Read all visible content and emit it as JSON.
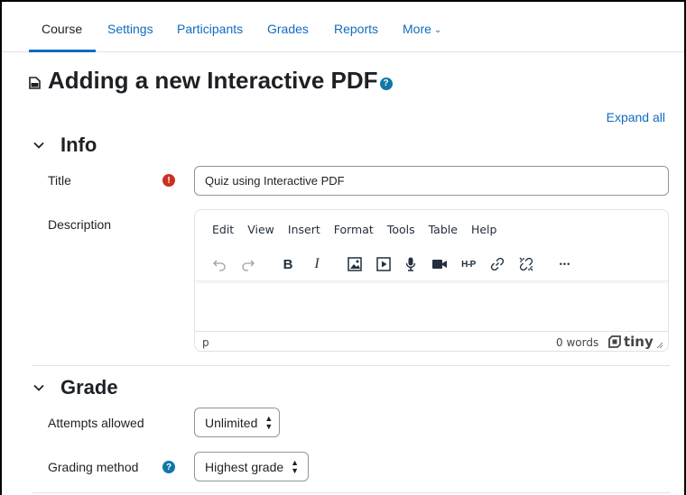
{
  "nav": {
    "tabs": [
      {
        "label": "Course",
        "active": true
      },
      {
        "label": "Settings"
      },
      {
        "label": "Participants"
      },
      {
        "label": "Grades"
      },
      {
        "label": "Reports"
      },
      {
        "label": "More"
      }
    ]
  },
  "page": {
    "title": "Adding a new Interactive PDF",
    "expand_all": "Expand all"
  },
  "info": {
    "section_title": "Info",
    "title_label": "Title",
    "title_value": "Quiz using Interactive PDF",
    "description_label": "Description"
  },
  "editor": {
    "menu": [
      "Edit",
      "View",
      "Insert",
      "Format",
      "Tools",
      "Table",
      "Help"
    ],
    "toolbar_icons": [
      "undo-icon",
      "redo-icon",
      "bold-icon",
      "italic-icon",
      "image-icon",
      "media-icon",
      "microphone-icon",
      "video-camera-icon",
      "h5p-icon",
      "link-icon",
      "unlink-icon",
      "more-icon"
    ],
    "bold_glyph": "B",
    "italic_glyph": "I",
    "h5p_glyph": "H-P",
    "more_glyph": "•••",
    "status_path": "p",
    "word_count": "0 words",
    "brand": "tiny"
  },
  "grade": {
    "section_title": "Grade",
    "attempts_label": "Attempts allowed",
    "attempts_value": "Unlimited",
    "grading_method_label": "Grading method",
    "grading_method_value": "Highest grade"
  },
  "colors": {
    "link": "#0f6cbf",
    "required": "#ca3120",
    "help": "#1177a8",
    "text": "#1d2125"
  }
}
